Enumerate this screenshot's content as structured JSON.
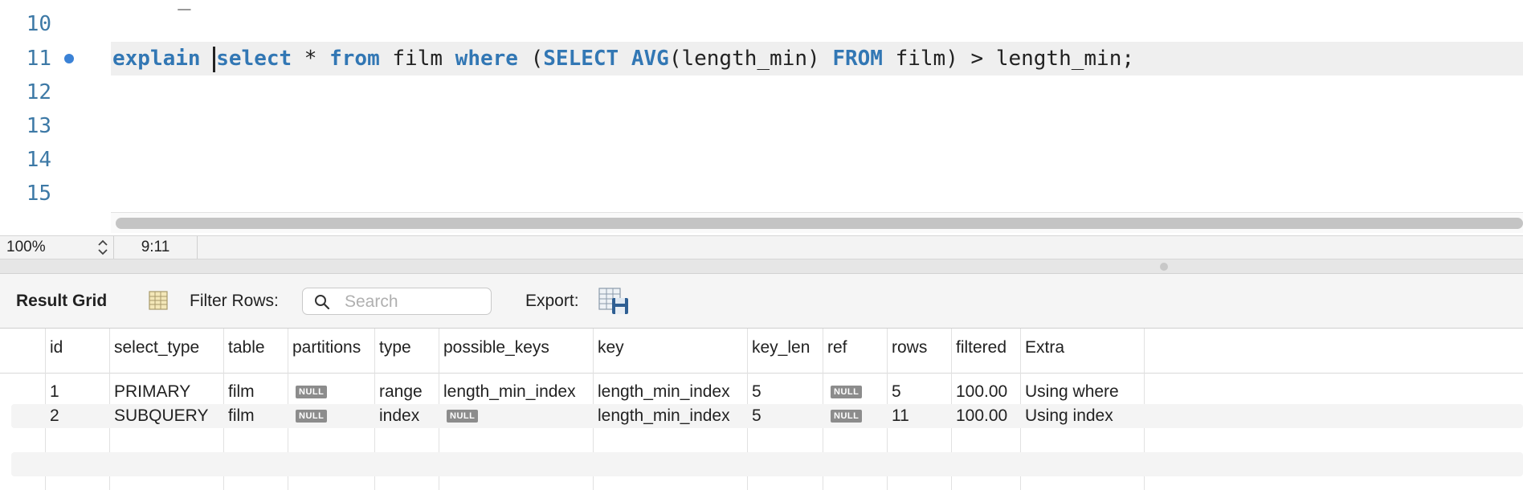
{
  "editor": {
    "cut_line": "_ ... )",
    "lines": [
      {
        "num": "10"
      },
      {
        "num": "11"
      },
      {
        "num": "12"
      },
      {
        "num": "13"
      },
      {
        "num": "14"
      },
      {
        "num": "15"
      }
    ],
    "code": {
      "t1": "explain",
      "t2": "select",
      "t3": " * ",
      "t4": "from",
      "t5": " film ",
      "t6": "where",
      "t7": " (",
      "t8": "SELECT",
      "t9": " ",
      "t10": "AVG",
      "t11": "(length_min) ",
      "t12": "FROM",
      "t13": " film) > length_min;"
    }
  },
  "status": {
    "zoom": "100%",
    "cursor": "9:11"
  },
  "toolbar": {
    "title": "Result Grid",
    "filter_label": "Filter Rows:",
    "search_placeholder": "Search",
    "export_label": "Export:"
  },
  "grid": {
    "columns": [
      "id",
      "select_type",
      "table",
      "partitions",
      "type",
      "possible_keys",
      "key",
      "key_len",
      "ref",
      "rows",
      "filtered",
      "Extra"
    ],
    "rows": [
      {
        "id": "1",
        "select_type": "PRIMARY",
        "table": "film",
        "partitions": "NULL",
        "type": "range",
        "possible_keys": "length_min_index",
        "key": "length_min_index",
        "key_len": "5",
        "ref": "NULL",
        "rows": "5",
        "filtered": "100.00",
        "extra": "Using where"
      },
      {
        "id": "2",
        "select_type": "SUBQUERY",
        "table": "film",
        "partitions": "NULL",
        "type": "index",
        "possible_keys": "NULL",
        "key": "length_min_index",
        "key_len": "5",
        "ref": "NULL",
        "rows": "11",
        "filtered": "100.00",
        "extra": "Using index"
      }
    ]
  },
  "colors": {
    "keyword": "#3277b4",
    "line_number": "#3d79a6",
    "breakpoint": "#3b82d6",
    "null_badge": "#8c8c8c"
  }
}
